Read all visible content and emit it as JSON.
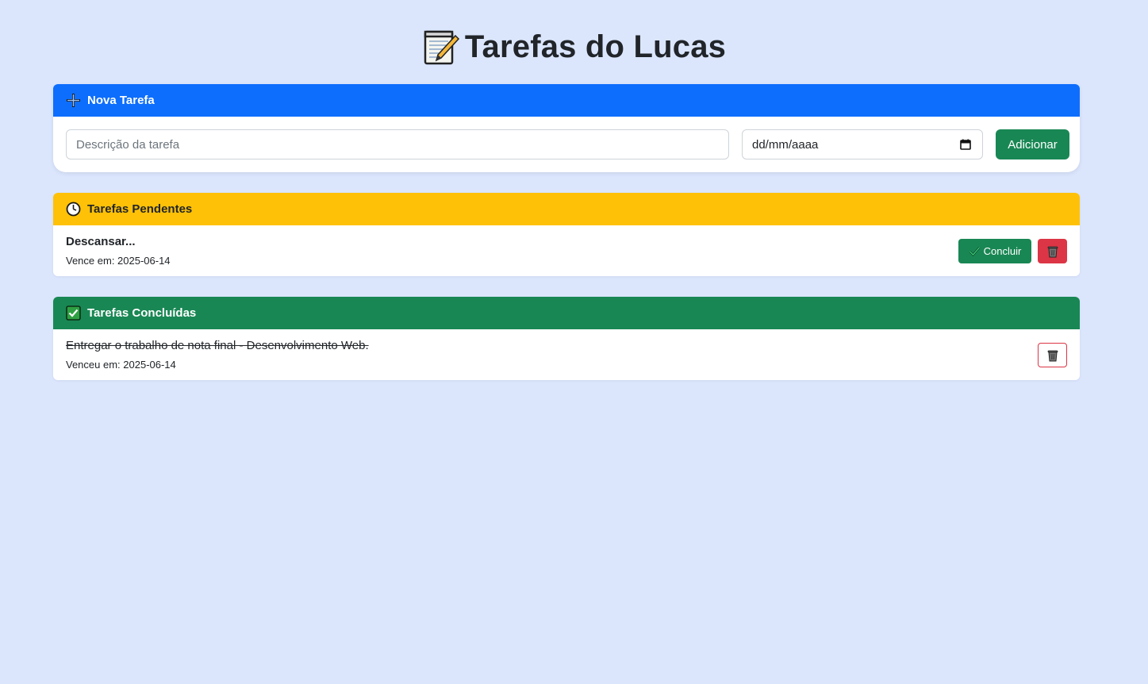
{
  "page": {
    "title": "Tarefas do Lucas",
    "title_icon": "memo-pencil-icon"
  },
  "new_task": {
    "header": "Nova Tarefa",
    "header_icon": "plus-icon",
    "description_placeholder": "Descrição da tarefa",
    "description_value": "",
    "date_placeholder": "dd/mm/aaaa",
    "date_icon": "calendar-icon",
    "add_label": "Adicionar"
  },
  "pending": {
    "header": "Tarefas Pendentes",
    "header_icon": "clock-icon",
    "items": [
      {
        "title": "Descansar...",
        "due": "Vence em: 2025-06-14",
        "conclude_label": "Concluir",
        "conclude_icon": "check-mark-icon",
        "delete_icon": "trash-icon"
      }
    ]
  },
  "done": {
    "header": "Tarefas Concluídas",
    "header_icon": "check-box-icon",
    "items": [
      {
        "title": "Entregar o trabalho de nota final - Desenvolvimento Web.",
        "due": "Venceu em: 2025-06-14",
        "delete_icon": "trash-icon"
      }
    ]
  },
  "colors": {
    "background": "#dbe6fd",
    "primary": "#0d6efd",
    "warning": "#ffc107",
    "success": "#198754",
    "danger": "#dc3545"
  }
}
